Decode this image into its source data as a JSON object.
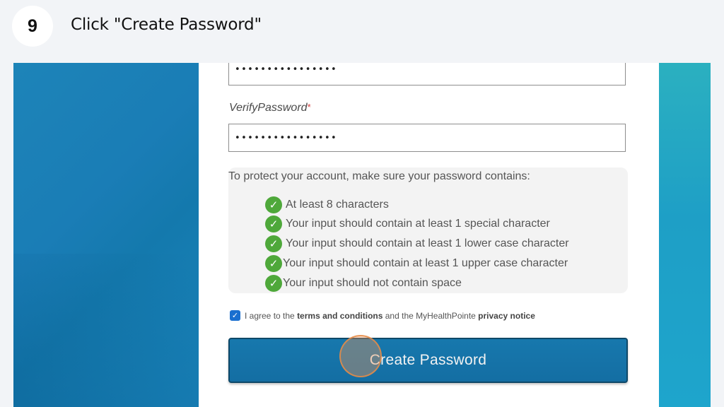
{
  "step": {
    "number": "9",
    "instruction": "Click \"Create Password\""
  },
  "form": {
    "password_mask": "••••••••••••••••",
    "verify_label": "VerifyPassword",
    "required_marker": "*",
    "verify_mask": "••••••••••••••••",
    "rules_intro": "To protect your account, make sure your password contains:",
    "rules": [
      "At least 8 characters",
      "Your input should contain at least 1 special character",
      "Your input should contain at least 1 lower case character",
      "Your input should contain at least 1 upper case character",
      "Your input should not contain space"
    ],
    "check_icon": "✓",
    "agree": {
      "checked": true,
      "prefix": "I agree to the ",
      "terms_link": "terms and conditions",
      "middle": " and the MyHealthPointe ",
      "privacy_link": "privacy notice"
    },
    "create_button": "Create Password"
  },
  "colors": {
    "accent_button": "#1778ad",
    "check_green": "#4ea83a",
    "required_red": "#d23b3b",
    "click_marker": "#e68c46"
  }
}
